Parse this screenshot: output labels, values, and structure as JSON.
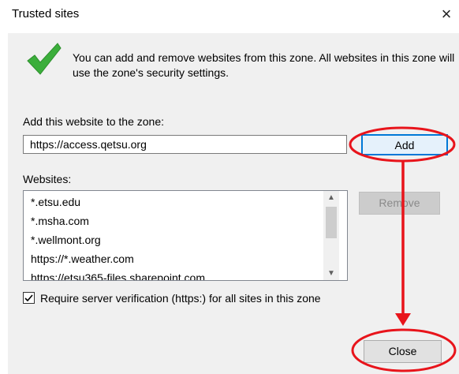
{
  "dialog": {
    "title": "Trusted sites",
    "close_glyph": "×"
  },
  "info": {
    "icon": "checkmark-icon",
    "message": "You can add and remove websites from this zone. All websites in this zone will use the zone's security settings."
  },
  "add_section": {
    "label": "Add this website to the zone:",
    "input_value": "https://access.qetsu.org",
    "add_button": "Add"
  },
  "websites": {
    "label": "Websites:",
    "items": [
      "*.etsu.edu",
      "*.msha.com",
      "*.wellmont.org",
      "https://*.weather.com",
      "https://etsu365-files.sharepoint.com"
    ],
    "remove_button": "Remove"
  },
  "scrollbar": {
    "up_glyph": "▲",
    "down_glyph": "▼"
  },
  "verification": {
    "label": "Require server verification (https:) for all sites in this zone",
    "checked": true
  },
  "close_button": "Close",
  "annotation_color": "#e8141b"
}
